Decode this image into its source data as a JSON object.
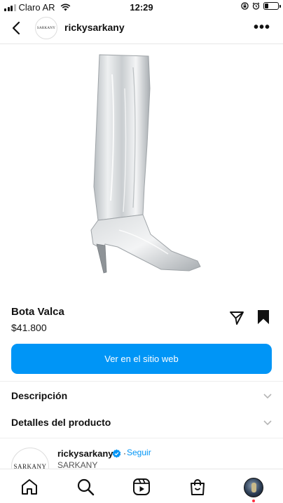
{
  "status_bar": {
    "carrier": "Claro AR",
    "time": "12:29",
    "battery_level": 0.3
  },
  "header": {
    "username": "rickysarkany",
    "avatar_text": "SARKANY",
    "back_icon": "chevron-left-icon",
    "more_icon": "more-horizontal-icon"
  },
  "product": {
    "name": "Bota Valca",
    "price": "$41.800",
    "image_icon": "silver-knee-high-boot"
  },
  "cta": {
    "label": "Ver en el sitio web",
    "color": "#0095f6"
  },
  "sections": {
    "description": "Descripción",
    "details": "Detalles del producto"
  },
  "profile": {
    "username": "rickysarkany",
    "separator": "·",
    "follow_label": "Seguir",
    "subtitle": "SARKANY",
    "avatar_text": "SARKANY",
    "verified_color": "#0095f6"
  },
  "bottom_nav": {
    "items": [
      "home-icon",
      "search-icon",
      "reels-icon",
      "shop-icon",
      "profile-avatar"
    ]
  }
}
